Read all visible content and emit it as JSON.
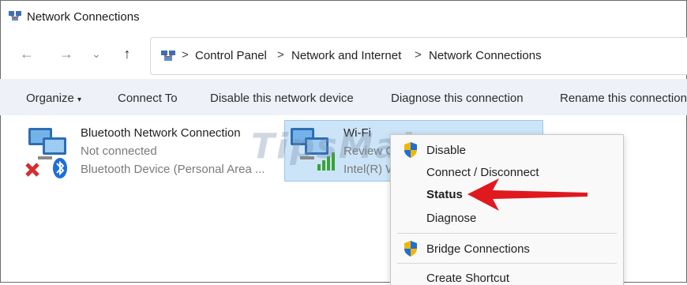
{
  "window": {
    "title": "Network Connections"
  },
  "nav": {
    "back": "←",
    "forward": "→",
    "recent": "⌄",
    "up": "↑"
  },
  "breadcrumb": {
    "separator": ">",
    "items": [
      "Control Panel",
      "Network and Internet",
      "Network Connections"
    ]
  },
  "toolbar": {
    "organize": "Organize",
    "organize_caret": "▾",
    "connect_to": "Connect To",
    "disable_device": "Disable this network device",
    "diagnose": "Diagnose this connection",
    "rename": "Rename this connection"
  },
  "connections": [
    {
      "name": "Bluetooth Network Connection",
      "status": "Not connected",
      "device": "Bluetooth Device (Personal Area ..."
    },
    {
      "name": "Wi-Fi",
      "status": "Review G",
      "device": "Intel(R) W"
    }
  ],
  "watermark": "TipsMake",
  "context_menu": {
    "items": [
      {
        "label": "Disable",
        "icon": "uac-shield-icon"
      },
      {
        "label": "Connect / Disconnect"
      },
      {
        "label": "Status",
        "bold": true
      },
      {
        "label": "Diagnose"
      },
      {
        "label": "Bridge Connections",
        "icon": "uac-shield-icon"
      },
      {
        "label": "Create Shortcut"
      }
    ]
  },
  "colors": {
    "toolbar_bg": "#eef2f8",
    "selection_bg": "#cce4f7",
    "arrow": "#e0191f"
  }
}
